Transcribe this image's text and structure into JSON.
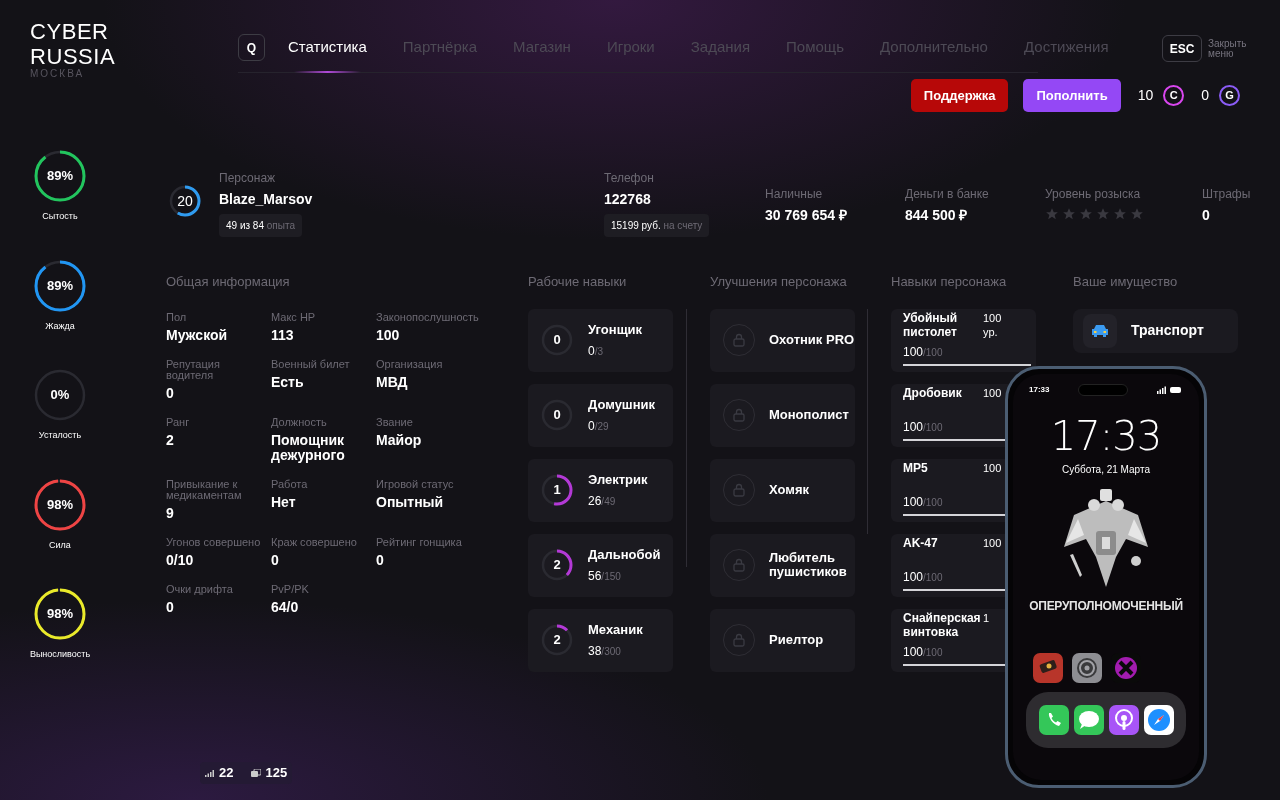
{
  "logo": {
    "line_1": "CYBER",
    "line_2": "RUSSIA",
    "city": "МОСКВА"
  },
  "search_key": "Q",
  "tabs": [
    {
      "label": "Статистика",
      "selected": true
    },
    {
      "label": "Партнёрка",
      "selected": false
    },
    {
      "label": "Магазин",
      "selected": false
    },
    {
      "label": "Игроки",
      "selected": false
    },
    {
      "label": "Задания",
      "selected": false
    },
    {
      "label": "Помощь",
      "selected": false
    },
    {
      "label": "Дополнительно",
      "selected": false
    },
    {
      "label": "Достижения",
      "selected": false
    }
  ],
  "close": {
    "key": "ESC",
    "label": "Закрыть меню"
  },
  "actions": {
    "support": "Поддержка",
    "top_up": "Пополнить"
  },
  "currencies": [
    {
      "amount": "10",
      "symbol": "C",
      "color": "#d946ef"
    },
    {
      "amount": "0",
      "symbol": "G",
      "color": "#8b5cf6"
    }
  ],
  "needs": [
    {
      "label": "Сытость",
      "value": "89%",
      "color": "#22c55e"
    },
    {
      "label": "Жажда",
      "value": "89%",
      "color": "#2196f3"
    },
    {
      "label": "Усталость",
      "value": "0%"
    },
    {
      "label": "Сила",
      "value": "98%",
      "color": "#ef4444"
    },
    {
      "label": "Выносливость",
      "value": "98%",
      "color": "#eaea2a"
    }
  ],
  "character": {
    "level_number": "20",
    "label": "Персонаж",
    "name": "Blaze_Marsov",
    "xp_current": "49",
    "xp_of": "из",
    "xp_total": "84",
    "xp_unit": "опыта"
  },
  "phone": {
    "label": "Телефон",
    "number": "122768",
    "balance": "15199 руб.",
    "balance_note": "на счету"
  },
  "money": [
    {
      "label": "Наличные",
      "value": "30 769 654 ₽"
    },
    {
      "label": "Деньги в банке",
      "value": "844 500 ₽"
    }
  ],
  "wanted": {
    "label": "Уровень розыска",
    "stars": 0
  },
  "fines": {
    "label": "Штрафы",
    "value": "0"
  },
  "general_info": {
    "title": "Общая информация",
    "items": [
      {
        "label": "Пол",
        "value": "Мужской"
      },
      {
        "label": "Макс HP",
        "value": "113"
      },
      {
        "label": "Законопослушность",
        "value": "100"
      },
      {
        "label": "Репутация водителя",
        "value": "0"
      },
      {
        "label": "Военный билет",
        "value": "Есть"
      },
      {
        "label": "Организация",
        "value": "МВД"
      },
      {
        "label": "Ранг",
        "value": "2"
      },
      {
        "label": "Должность",
        "value": "Помощник дежурного"
      },
      {
        "label": "Звание",
        "value": "Майор"
      },
      {
        "label": "Привыкание к медикаментам",
        "value": "9"
      },
      {
        "label": "Работа",
        "value": "Нет"
      },
      {
        "label": "Игровой статус",
        "value": "Опытный"
      },
      {
        "label": "Угонов совершено",
        "value": "0/10"
      },
      {
        "label": "Краж совершено",
        "value": "0"
      },
      {
        "label": "Рейтинг гонщика",
        "value": "0"
      },
      {
        "label": "Очки дрифта",
        "value": "0"
      },
      {
        "label": "PvP/PK",
        "value": "64/0"
      }
    ]
  },
  "work_skills": {
    "title": "Рабочие навыки",
    "items": [
      {
        "rank": "0",
        "name": "Угонщик",
        "value": "0",
        "total": "/3"
      },
      {
        "rank": "0",
        "name": "Домушник",
        "value": "0",
        "total": "/29"
      },
      {
        "rank": "1",
        "name": "Электрик",
        "value": "26",
        "total": "/49"
      },
      {
        "rank": "2",
        "name": "Дальнобой",
        "value": "56",
        "total": "/150"
      },
      {
        "rank": "2",
        "name": "Механик",
        "value": "38",
        "total": "/300"
      }
    ]
  },
  "upgrades": {
    "title": "Улучшения персонажа",
    "items": [
      {
        "name": "Охотник PRO",
        "locked": true
      },
      {
        "name": "Монополист",
        "locked": true
      },
      {
        "name": "Хомяк",
        "locked": true
      },
      {
        "name": "Любитель пушистиков",
        "locked": true
      },
      {
        "name": "Риелтор",
        "locked": true
      }
    ]
  },
  "weapon_skills": {
    "title": "Навыки персонажа",
    "items": [
      {
        "name": "Убойный пистолет",
        "rank": "100 ур.",
        "value": "100",
        "total": "/100",
        "level": 1
      },
      {
        "name": "Дробовик",
        "rank": "100",
        "value": "100",
        "total": "/100",
        "level": 1
      },
      {
        "name": "MP5",
        "rank": "100",
        "value": "100",
        "total": "/100",
        "level": 1
      },
      {
        "name": "AK-47",
        "rank": "100",
        "value": "100",
        "total": "/100",
        "level": 1
      },
      {
        "name": "Снайперская винтовка",
        "rank": "1",
        "value": "100",
        "total": "/100",
        "level": 1
      }
    ]
  },
  "property": {
    "title": "Ваше имущество",
    "items": [
      {
        "name": "Транспорт"
      }
    ]
  },
  "phone_screen": {
    "status_time": "17:33",
    "clock": "17:33",
    "date": "Суббота, 21 Марта",
    "caption": "ОПЕРУПОЛНОМОЧЕННЫЙ"
  },
  "network": {
    "ping": "22",
    "fps": "125"
  }
}
